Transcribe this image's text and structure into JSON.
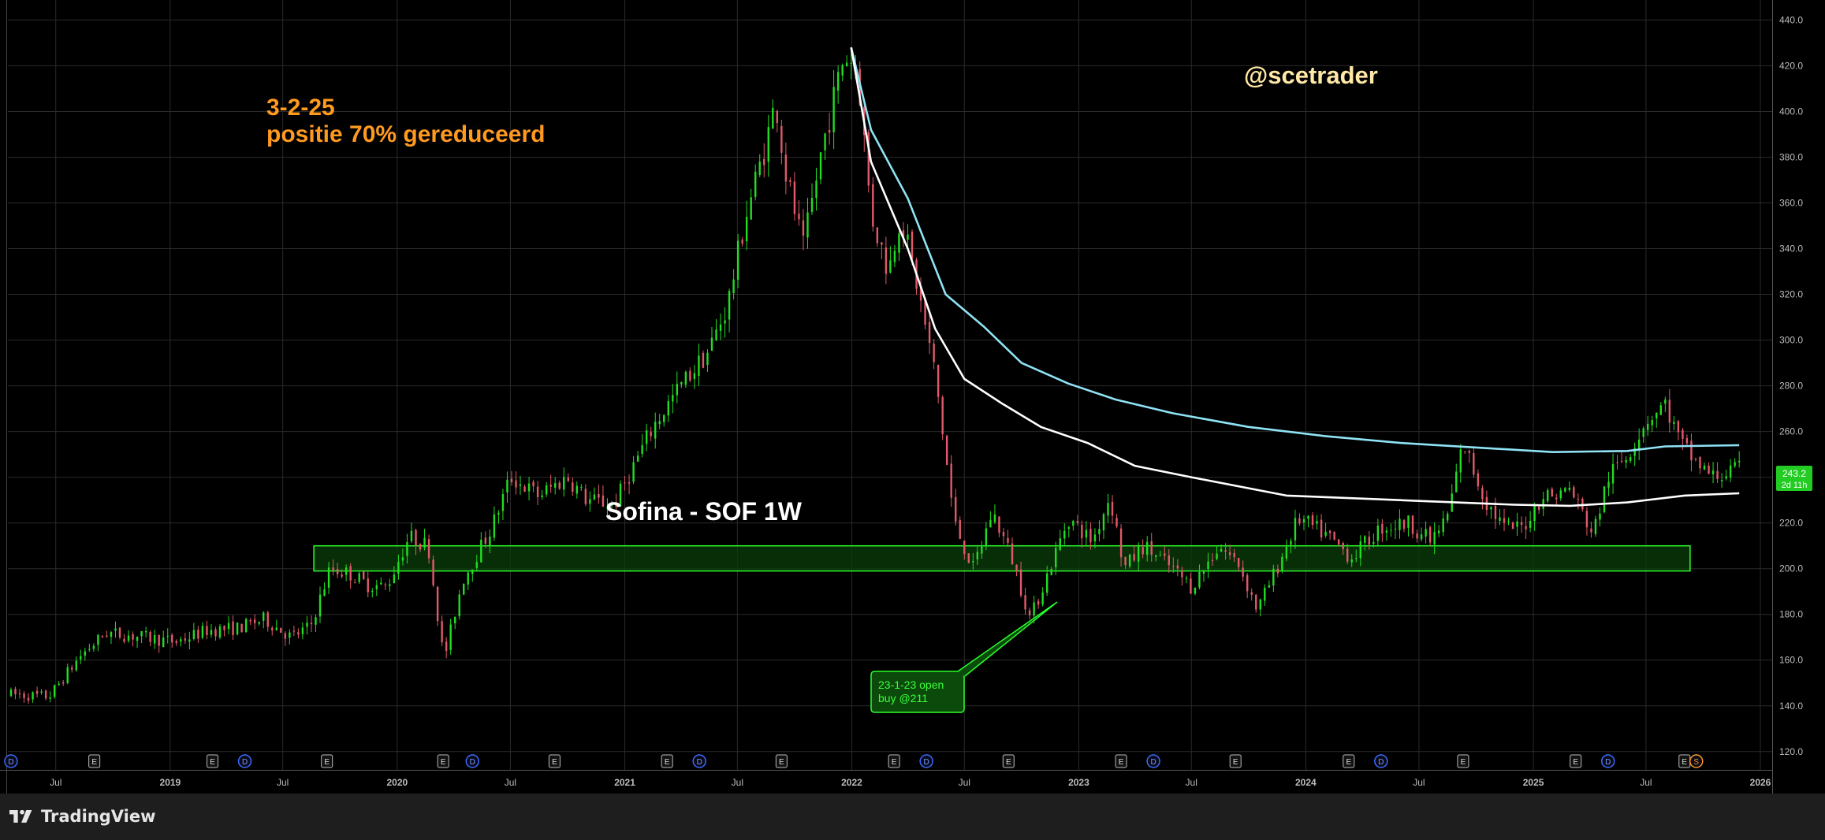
{
  "colors": {
    "background": "#000000",
    "grid": "#2a2a2a",
    "up_candle": "#22dd22",
    "down_candle": "#e05a6a",
    "ma_long": "#8fe3f5",
    "ma_short": "#ffffff",
    "zone_fill": "#0b3d0b",
    "zone_stroke": "#2bff2b",
    "annotation_orange": "#ff9a1f",
    "handle_yellow": "#ffe9a6",
    "title_white": "#ffffff",
    "axis_text": "#bdbdbd",
    "price_tag_bg": "#22cc22"
  },
  "texts": {
    "handle": "@scetrader",
    "note_line1": "3-2-25",
    "note_line2": "positie 70% gereduceerd",
    "title": "Sofina - SOF 1W",
    "callout_line1": "23-1-23 open",
    "callout_line2": "buy @211",
    "brand": "TradingView",
    "price_tag_value": "243.2",
    "price_tag_time": "2d 11h"
  },
  "chart_data": {
    "type": "candlestick",
    "symbol": "Sofina - SOF",
    "interval": "1W",
    "x_range": [
      "2018-04-15",
      "2026-01-20"
    ],
    "ylim": [
      112,
      446
    ],
    "y_ticks": [
      120,
      140,
      160,
      180,
      200,
      220,
      240,
      260,
      280,
      300,
      320,
      340,
      360,
      380,
      400,
      420,
      440
    ],
    "x_ticks": [
      {
        "label": "Jul",
        "date": "2018-07-01"
      },
      {
        "label": "2019",
        "date": "2019-01-01"
      },
      {
        "label": "Jul",
        "date": "2019-07-01"
      },
      {
        "label": "2020",
        "date": "2020-01-01"
      },
      {
        "label": "Jul",
        "date": "2020-07-01"
      },
      {
        "label": "2021",
        "date": "2021-01-01"
      },
      {
        "label": "Jul",
        "date": "2021-07-01"
      },
      {
        "label": "2022",
        "date": "2022-01-01"
      },
      {
        "label": "Jul",
        "date": "2022-07-01"
      },
      {
        "label": "2023",
        "date": "2023-01-01"
      },
      {
        "label": "Jul",
        "date": "2023-07-01"
      },
      {
        "label": "2024",
        "date": "2024-01-01"
      },
      {
        "label": "Jul",
        "date": "2024-07-01"
      },
      {
        "label": "2025",
        "date": "2025-01-01"
      },
      {
        "label": "Jul",
        "date": "2025-07-01"
      },
      {
        "label": "2026",
        "date": "2026-01-01"
      }
    ],
    "grid": true,
    "price_anchors": [
      [
        "2018-04-20",
        145
      ],
      [
        "2018-06-20",
        144
      ],
      [
        "2018-08-10",
        162
      ],
      [
        "2018-09-20",
        172
      ],
      [
        "2018-11-20",
        170
      ],
      [
        "2019-01-10",
        168
      ],
      [
        "2019-03-01",
        173
      ],
      [
        "2019-04-20",
        174
      ],
      [
        "2019-06-01",
        178
      ],
      [
        "2019-07-15",
        170
      ],
      [
        "2019-08-15",
        175
      ],
      [
        "2019-09-15",
        200
      ],
      [
        "2019-10-15",
        198
      ],
      [
        "2019-11-15",
        193
      ],
      [
        "2019-12-15",
        192
      ],
      [
        "2020-01-20",
        214
      ],
      [
        "2020-02-20",
        210
      ],
      [
        "2020-03-16",
        160
      ],
      [
        "2020-04-15",
        195
      ],
      [
        "2020-06-01",
        218
      ],
      [
        "2020-07-01",
        240
      ],
      [
        "2020-08-15",
        232
      ],
      [
        "2020-10-01",
        240
      ],
      [
        "2020-11-01",
        230
      ],
      [
        "2020-12-15",
        228
      ],
      [
        "2021-01-15",
        245
      ],
      [
        "2021-02-15",
        262
      ],
      [
        "2021-04-01",
        280
      ],
      [
        "2021-05-15",
        295
      ],
      [
        "2021-06-15",
        315
      ],
      [
        "2021-07-15",
        355
      ],
      [
        "2021-08-15",
        385
      ],
      [
        "2021-09-01",
        405
      ],
      [
        "2021-09-15",
        375
      ],
      [
        "2021-10-15",
        340
      ],
      [
        "2021-11-15",
        385
      ],
      [
        "2021-12-20",
        425
      ],
      [
        "2022-01-10",
        420
      ],
      [
        "2022-02-01",
        355
      ],
      [
        "2022-03-01",
        330
      ],
      [
        "2022-03-20",
        355
      ],
      [
        "2022-04-15",
        325
      ],
      [
        "2022-05-15",
        285
      ],
      [
        "2022-06-15",
        220
      ],
      [
        "2022-07-15",
        200
      ],
      [
        "2022-08-15",
        225
      ],
      [
        "2022-09-15",
        205
      ],
      [
        "2022-10-15",
        178
      ],
      [
        "2022-11-15",
        200
      ],
      [
        "2022-12-15",
        222
      ],
      [
        "2023-01-23",
        212
      ],
      [
        "2023-02-20",
        232
      ],
      [
        "2023-03-15",
        200
      ],
      [
        "2023-04-15",
        210
      ],
      [
        "2023-06-01",
        200
      ],
      [
        "2023-07-01",
        192
      ],
      [
        "2023-08-15",
        210
      ],
      [
        "2023-09-15",
        202
      ],
      [
        "2023-10-15",
        182
      ],
      [
        "2023-11-15",
        200
      ],
      [
        "2023-12-20",
        222
      ],
      [
        "2024-02-01",
        215
      ],
      [
        "2024-03-15",
        205
      ],
      [
        "2024-05-01",
        218
      ],
      [
        "2024-06-15",
        220
      ],
      [
        "2024-07-20",
        212
      ],
      [
        "2024-08-15",
        222
      ],
      [
        "2024-09-10",
        255
      ],
      [
        "2024-10-15",
        230
      ],
      [
        "2024-11-15",
        218
      ],
      [
        "2024-12-15",
        218
      ],
      [
        "2025-01-15",
        232
      ],
      [
        "2025-02-03",
        232
      ],
      [
        "2025-03-01",
        235
      ],
      [
        "2025-04-07",
        215
      ],
      [
        "2025-05-01",
        240
      ],
      [
        "2025-06-01",
        250
      ],
      [
        "2025-07-01",
        265
      ],
      [
        "2025-08-01",
        272
      ],
      [
        "2025-08-25",
        255
      ],
      [
        "2025-09-15",
        248
      ],
      [
        "2025-10-15",
        240
      ],
      [
        "2025-11-28",
        243.2
      ]
    ],
    "series": [
      {
        "kind": "moving-average",
        "color": "#8fe3f5",
        "points": [
          [
            "2021-12-31",
            428
          ],
          [
            "2022-02-01",
            392
          ],
          [
            "2022-04-01",
            362
          ],
          [
            "2022-06-01",
            320
          ],
          [
            "2022-08-01",
            306
          ],
          [
            "2022-10-01",
            290
          ],
          [
            "2022-12-15",
            281
          ],
          [
            "2023-03-01",
            274
          ],
          [
            "2023-06-01",
            268
          ],
          [
            "2023-10-01",
            262
          ],
          [
            "2024-02-01",
            258
          ],
          [
            "2024-06-01",
            255
          ],
          [
            "2024-10-01",
            253
          ],
          [
            "2025-02-01",
            251
          ],
          [
            "2025-06-01",
            251.5
          ],
          [
            "2025-08-01",
            253.5
          ],
          [
            "2025-11-28",
            254
          ]
        ]
      },
      {
        "kind": "moving-average",
        "color": "#ffffff",
        "points": [
          [
            "2021-12-31",
            428
          ],
          [
            "2022-02-01",
            378
          ],
          [
            "2022-04-01",
            340
          ],
          [
            "2022-05-15",
            305
          ],
          [
            "2022-07-01",
            283
          ],
          [
            "2022-09-01",
            272
          ],
          [
            "2022-11-01",
            262
          ],
          [
            "2023-01-15",
            255
          ],
          [
            "2023-04-01",
            245
          ],
          [
            "2023-07-01",
            240
          ],
          [
            "2023-12-01",
            232
          ],
          [
            "2024-06-01",
            230
          ],
          [
            "2024-12-01",
            228
          ],
          [
            "2025-03-01",
            227.5
          ],
          [
            "2025-06-01",
            229
          ],
          [
            "2025-09-01",
            232
          ],
          [
            "2025-11-28",
            233
          ]
        ]
      }
    ],
    "support_zone": {
      "from": "2019-08-20",
      "to": "2025-09-10",
      "low": 199,
      "high": 210
    },
    "last_price": 243.2,
    "events": [
      {
        "label": "D",
        "date": "2018-04-20",
        "kind": "dividend"
      },
      {
        "label": "E",
        "date": "2018-09-01",
        "kind": "earnings"
      },
      {
        "label": "E",
        "date": "2019-03-10",
        "kind": "earnings"
      },
      {
        "label": "D",
        "date": "2019-05-01",
        "kind": "dividend"
      },
      {
        "label": "E",
        "date": "2019-09-10",
        "kind": "earnings"
      },
      {
        "label": "E",
        "date": "2020-03-15",
        "kind": "earnings"
      },
      {
        "label": "D",
        "date": "2020-05-01",
        "kind": "dividend"
      },
      {
        "label": "E",
        "date": "2020-09-10",
        "kind": "earnings"
      },
      {
        "label": "E",
        "date": "2021-03-10",
        "kind": "earnings"
      },
      {
        "label": "D",
        "date": "2021-05-01",
        "kind": "dividend"
      },
      {
        "label": "E",
        "date": "2021-09-10",
        "kind": "earnings"
      },
      {
        "label": "E",
        "date": "2022-03-10",
        "kind": "earnings"
      },
      {
        "label": "D",
        "date": "2022-05-01",
        "kind": "dividend"
      },
      {
        "label": "E",
        "date": "2022-09-10",
        "kind": "earnings"
      },
      {
        "label": "E",
        "date": "2023-03-10",
        "kind": "earnings"
      },
      {
        "label": "D",
        "date": "2023-05-01",
        "kind": "dividend"
      },
      {
        "label": "E",
        "date": "2023-09-10",
        "kind": "earnings"
      },
      {
        "label": "E",
        "date": "2024-03-10",
        "kind": "earnings"
      },
      {
        "label": "D",
        "date": "2024-05-01",
        "kind": "dividend"
      },
      {
        "label": "E",
        "date": "2024-09-10",
        "kind": "earnings"
      },
      {
        "label": "E",
        "date": "2025-03-10",
        "kind": "earnings"
      },
      {
        "label": "D",
        "date": "2025-05-01",
        "kind": "dividend"
      },
      {
        "label": "E",
        "date": "2025-09-01",
        "kind": "earnings"
      },
      {
        "label": "S",
        "date": "2025-09-20",
        "kind": "split"
      }
    ]
  }
}
